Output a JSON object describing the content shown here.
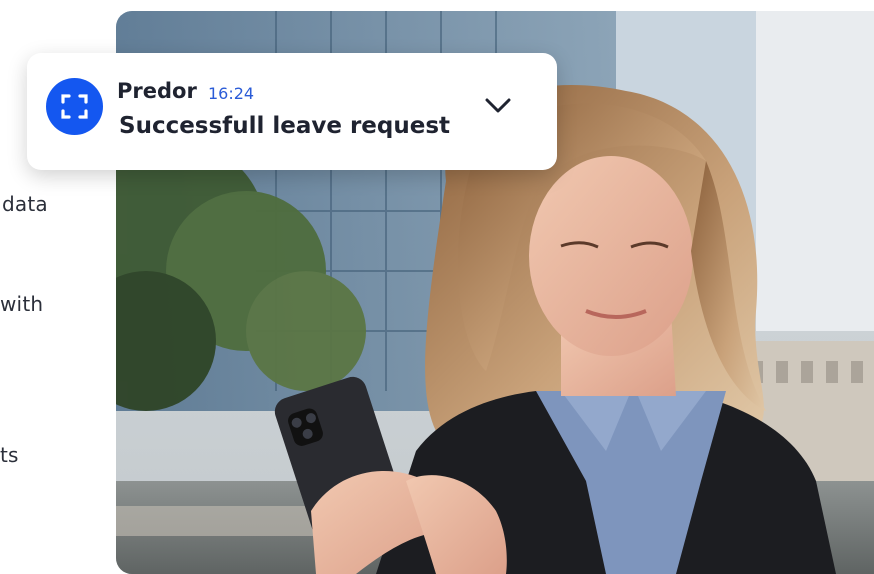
{
  "side_text": {
    "line1": " data",
    "line2": "with",
    "line3": "ts"
  },
  "notification": {
    "app_name": "Predor",
    "time": "16:24",
    "message": "Successfull leave request",
    "icon": "scan-frame-icon",
    "accent_color": "#1457f0",
    "expand_icon": "chevron-down-icon"
  },
  "photo": {
    "subject": "woman-using-smartphone-photo"
  }
}
